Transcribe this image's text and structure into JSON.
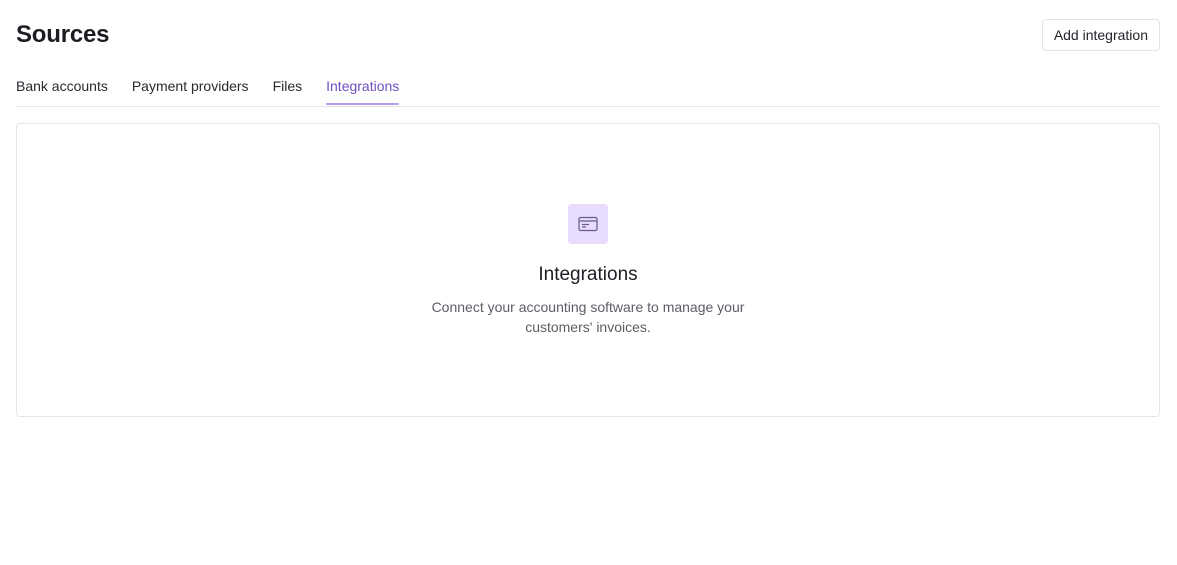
{
  "header": {
    "title": "Sources",
    "add_button_label": "Add integration"
  },
  "tabs": [
    {
      "label": "Bank accounts",
      "active": false
    },
    {
      "label": "Payment providers",
      "active": false
    },
    {
      "label": "Files",
      "active": false
    },
    {
      "label": "Integrations",
      "active": true
    }
  ],
  "empty_state": {
    "icon": "credit-card-icon",
    "title": "Integrations",
    "description": "Connect your accounting software to manage your customers' invoices."
  },
  "colors": {
    "accent": "#6e4fbf",
    "accent_underline": "#b79cef",
    "icon_tile_bg": "#e7dcfb"
  }
}
